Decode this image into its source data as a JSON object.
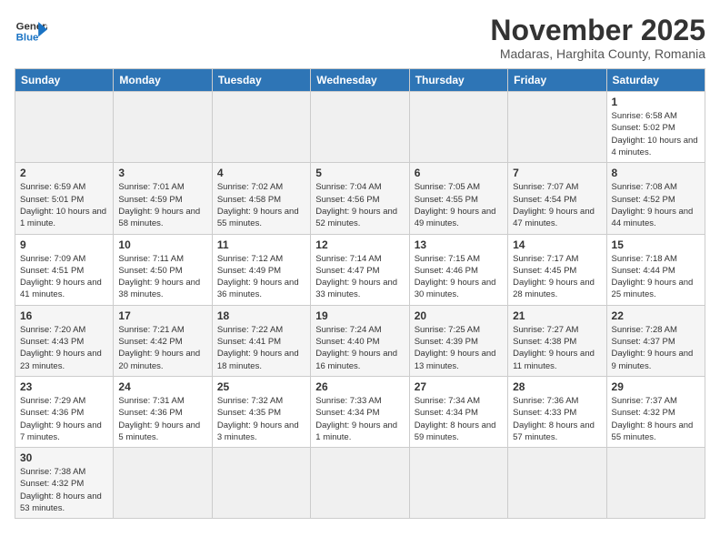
{
  "header": {
    "logo_line1": "General",
    "logo_line2": "Blue",
    "month": "November 2025",
    "location": "Madaras, Harghita County, Romania"
  },
  "days_of_week": [
    "Sunday",
    "Monday",
    "Tuesday",
    "Wednesday",
    "Thursday",
    "Friday",
    "Saturday"
  ],
  "weeks": [
    [
      {
        "day": "",
        "info": ""
      },
      {
        "day": "",
        "info": ""
      },
      {
        "day": "",
        "info": ""
      },
      {
        "day": "",
        "info": ""
      },
      {
        "day": "",
        "info": ""
      },
      {
        "day": "",
        "info": ""
      },
      {
        "day": "1",
        "info": "Sunrise: 6:58 AM\nSunset: 5:02 PM\nDaylight: 10 hours and 4 minutes."
      }
    ],
    [
      {
        "day": "2",
        "info": "Sunrise: 6:59 AM\nSunset: 5:01 PM\nDaylight: 10 hours and 1 minute."
      },
      {
        "day": "3",
        "info": "Sunrise: 7:01 AM\nSunset: 4:59 PM\nDaylight: 9 hours and 58 minutes."
      },
      {
        "day": "4",
        "info": "Sunrise: 7:02 AM\nSunset: 4:58 PM\nDaylight: 9 hours and 55 minutes."
      },
      {
        "day": "5",
        "info": "Sunrise: 7:04 AM\nSunset: 4:56 PM\nDaylight: 9 hours and 52 minutes."
      },
      {
        "day": "6",
        "info": "Sunrise: 7:05 AM\nSunset: 4:55 PM\nDaylight: 9 hours and 49 minutes."
      },
      {
        "day": "7",
        "info": "Sunrise: 7:07 AM\nSunset: 4:54 PM\nDaylight: 9 hours and 47 minutes."
      },
      {
        "day": "8",
        "info": "Sunrise: 7:08 AM\nSunset: 4:52 PM\nDaylight: 9 hours and 44 minutes."
      }
    ],
    [
      {
        "day": "9",
        "info": "Sunrise: 7:09 AM\nSunset: 4:51 PM\nDaylight: 9 hours and 41 minutes."
      },
      {
        "day": "10",
        "info": "Sunrise: 7:11 AM\nSunset: 4:50 PM\nDaylight: 9 hours and 38 minutes."
      },
      {
        "day": "11",
        "info": "Sunrise: 7:12 AM\nSunset: 4:49 PM\nDaylight: 9 hours and 36 minutes."
      },
      {
        "day": "12",
        "info": "Sunrise: 7:14 AM\nSunset: 4:47 PM\nDaylight: 9 hours and 33 minutes."
      },
      {
        "day": "13",
        "info": "Sunrise: 7:15 AM\nSunset: 4:46 PM\nDaylight: 9 hours and 30 minutes."
      },
      {
        "day": "14",
        "info": "Sunrise: 7:17 AM\nSunset: 4:45 PM\nDaylight: 9 hours and 28 minutes."
      },
      {
        "day": "15",
        "info": "Sunrise: 7:18 AM\nSunset: 4:44 PM\nDaylight: 9 hours and 25 minutes."
      }
    ],
    [
      {
        "day": "16",
        "info": "Sunrise: 7:20 AM\nSunset: 4:43 PM\nDaylight: 9 hours and 23 minutes."
      },
      {
        "day": "17",
        "info": "Sunrise: 7:21 AM\nSunset: 4:42 PM\nDaylight: 9 hours and 20 minutes."
      },
      {
        "day": "18",
        "info": "Sunrise: 7:22 AM\nSunset: 4:41 PM\nDaylight: 9 hours and 18 minutes."
      },
      {
        "day": "19",
        "info": "Sunrise: 7:24 AM\nSunset: 4:40 PM\nDaylight: 9 hours and 16 minutes."
      },
      {
        "day": "20",
        "info": "Sunrise: 7:25 AM\nSunset: 4:39 PM\nDaylight: 9 hours and 13 minutes."
      },
      {
        "day": "21",
        "info": "Sunrise: 7:27 AM\nSunset: 4:38 PM\nDaylight: 9 hours and 11 minutes."
      },
      {
        "day": "22",
        "info": "Sunrise: 7:28 AM\nSunset: 4:37 PM\nDaylight: 9 hours and 9 minutes."
      }
    ],
    [
      {
        "day": "23",
        "info": "Sunrise: 7:29 AM\nSunset: 4:36 PM\nDaylight: 9 hours and 7 minutes."
      },
      {
        "day": "24",
        "info": "Sunrise: 7:31 AM\nSunset: 4:36 PM\nDaylight: 9 hours and 5 minutes."
      },
      {
        "day": "25",
        "info": "Sunrise: 7:32 AM\nSunset: 4:35 PM\nDaylight: 9 hours and 3 minutes."
      },
      {
        "day": "26",
        "info": "Sunrise: 7:33 AM\nSunset: 4:34 PM\nDaylight: 9 hours and 1 minute."
      },
      {
        "day": "27",
        "info": "Sunrise: 7:34 AM\nSunset: 4:34 PM\nDaylight: 8 hours and 59 minutes."
      },
      {
        "day": "28",
        "info": "Sunrise: 7:36 AM\nSunset: 4:33 PM\nDaylight: 8 hours and 57 minutes."
      },
      {
        "day": "29",
        "info": "Sunrise: 7:37 AM\nSunset: 4:32 PM\nDaylight: 8 hours and 55 minutes."
      }
    ],
    [
      {
        "day": "30",
        "info": "Sunrise: 7:38 AM\nSunset: 4:32 PM\nDaylight: 8 hours and 53 minutes."
      },
      {
        "day": "",
        "info": ""
      },
      {
        "day": "",
        "info": ""
      },
      {
        "day": "",
        "info": ""
      },
      {
        "day": "",
        "info": ""
      },
      {
        "day": "",
        "info": ""
      },
      {
        "day": "",
        "info": ""
      }
    ]
  ]
}
